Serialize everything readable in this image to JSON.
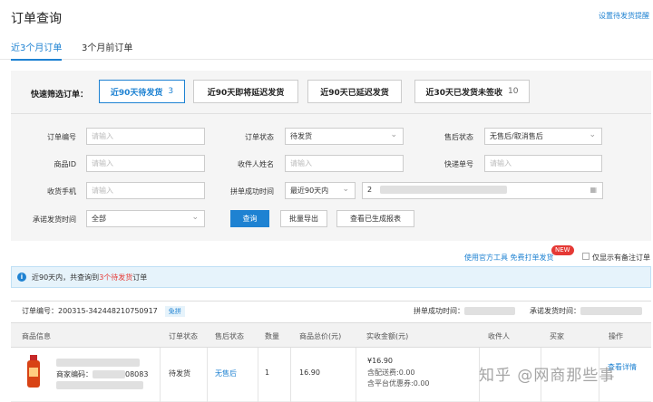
{
  "page": {
    "title": "订单查询",
    "setting_link": "设置待发货提醒"
  },
  "tabs": [
    {
      "label": "近3个月订单",
      "active": true
    },
    {
      "label": "3个月前订单",
      "active": false
    }
  ],
  "quick_filter": {
    "label": "快速筛选订单：",
    "chips": [
      {
        "label": "近90天待发货",
        "count": "3",
        "active": true
      },
      {
        "label": "近90天即将延迟发货",
        "count": "",
        "active": false
      },
      {
        "label": "近90天已延迟发货",
        "count": "",
        "active": false
      },
      {
        "label": "近30天已发货未签收",
        "count": "10",
        "active": false
      }
    ]
  },
  "form": {
    "order_no": {
      "label": "订单编号",
      "placeholder": "请输入"
    },
    "order_status": {
      "label": "订单状态",
      "value": "待发货"
    },
    "after_sale": {
      "label": "售后状态",
      "value": "无售后/取消售后"
    },
    "product_id": {
      "label": "商品ID",
      "placeholder": "请输入"
    },
    "receiver": {
      "label": "收件人姓名",
      "placeholder": "请输入"
    },
    "tracking_no": {
      "label": "快递单号",
      "placeholder": "请输入"
    },
    "phone": {
      "label": "收货手机",
      "placeholder": "请输入"
    },
    "group_time": {
      "label": "拼单成功时间",
      "range_value": "最近90天内",
      "date_prefix": "2"
    },
    "promise_time": {
      "label": "承诺发货时间",
      "value": "全部"
    }
  },
  "buttons": {
    "query": "查询",
    "export": "批量导出",
    "report": "查看已生成报表"
  },
  "tools": {
    "official_link": "使用官方工具 免费打单发货",
    "new_badge": "NEW",
    "remark_only": "仅显示有备注订单"
  },
  "info": {
    "prefix": "近90天内，共查询到",
    "count": "3个",
    "status": "待发货",
    "suffix": "订单"
  },
  "order": {
    "order_no_label": "订单编号：",
    "order_no": "200315-342448210750917",
    "tag": "免拼",
    "group_time_label": "拼单成功时间：",
    "promise_label": "承诺发货时间："
  },
  "columns": [
    "商品信息",
    "订单状态",
    "售后状态",
    "数量",
    "商品总价(元)",
    "实收金额(元)",
    "收件人",
    "买家",
    "操作"
  ],
  "row": {
    "product_code_prefix": "商家编码：",
    "product_code_tail": "08083",
    "status": "待发货",
    "after_sale": "无售后",
    "qty": "1",
    "total": "16.90",
    "paid": "¥16.90",
    "shipping": "含配送费:0.00",
    "discount": "含平台优惠券:0.00",
    "action": "查看详情"
  },
  "watermark": "知乎 @网商那些事",
  "colors": {
    "accent": "#1e82d2",
    "highlight": "#e53935",
    "info_bg": "#e6f3fb"
  }
}
